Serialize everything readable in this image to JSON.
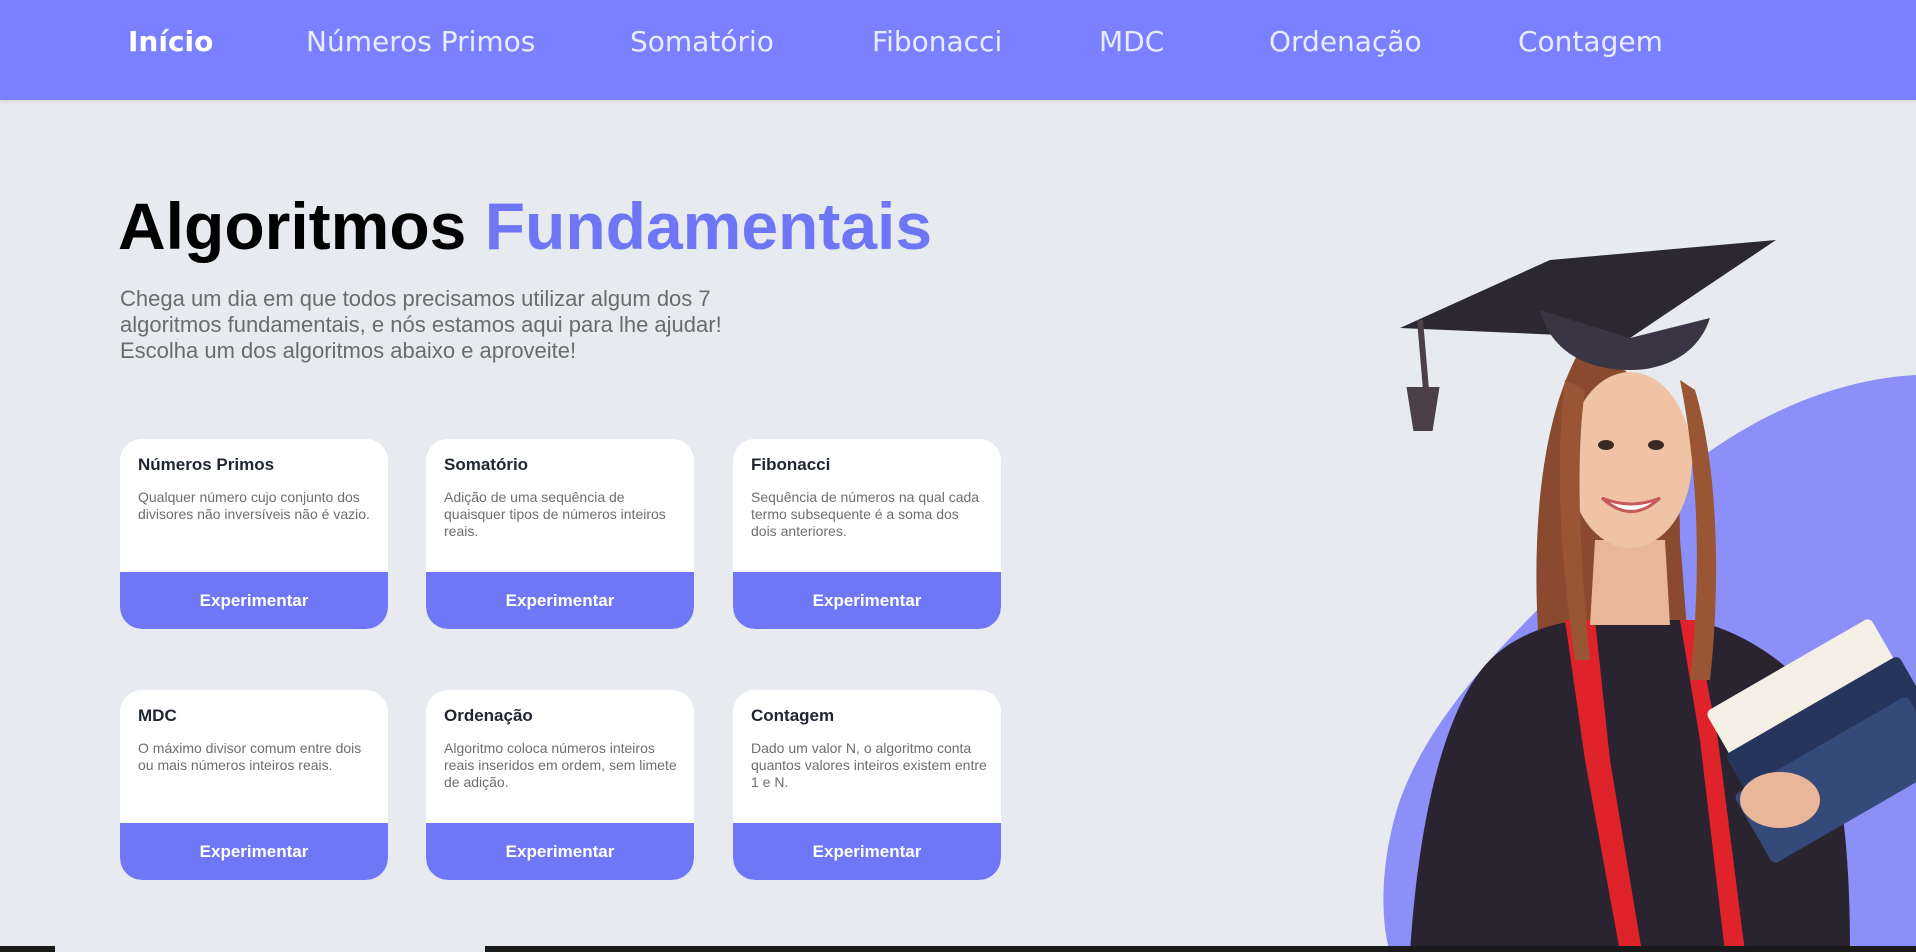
{
  "nav": {
    "items": [
      {
        "label": "Início",
        "active": true
      },
      {
        "label": "Números Primos"
      },
      {
        "label": "Somatório"
      },
      {
        "label": "Fibonacci"
      },
      {
        "label": "MDC"
      },
      {
        "label": "Ordenação"
      },
      {
        "label": "Contagem"
      }
    ]
  },
  "hero": {
    "title_main": "Algoritmos",
    "title_accent": "Fundamentais",
    "description_lines": [
      "Chega um dia em que todos precisamos utilizar algum dos 7",
      "algoritmos fundamentais, e nós estamos aqui para lhe ajudar!",
      "Escolha um dos algoritmos abaixo e aproveite!"
    ]
  },
  "cards": [
    {
      "title": "Números Primos",
      "description": "Qualquer número cujo conjunto dos divisores não inversíveis não é vazio.",
      "button": "Experimentar"
    },
    {
      "title": "Somatório",
      "description": "Adição de uma sequência de quaisquer tipos de números inteiros reais.",
      "button": "Experimentar"
    },
    {
      "title": "Fibonacci",
      "description": "Sequência de números na qual cada termo subsequente é a soma dos dois anteriores.",
      "button": "Experimentar"
    },
    {
      "title": "MDC",
      "description": "O máximo divisor comum entre dois ou mais números inteiros reais.",
      "button": "Experimentar"
    },
    {
      "title": "Ordenação",
      "description": "Algoritmo coloca números inteiros reais inseridos em ordem, sem limete de adição.",
      "button": "Experimentar"
    },
    {
      "title": "Contagem",
      "description": "Dado um valor N, o algoritmo conta quantos valores inteiros existem entre 1 e N.",
      "button": "Experimentar"
    }
  ],
  "colors": {
    "accent": "#7a80ff",
    "button": "#7077f6",
    "background": "#e7ebef",
    "blob": "#8b8ff7"
  }
}
